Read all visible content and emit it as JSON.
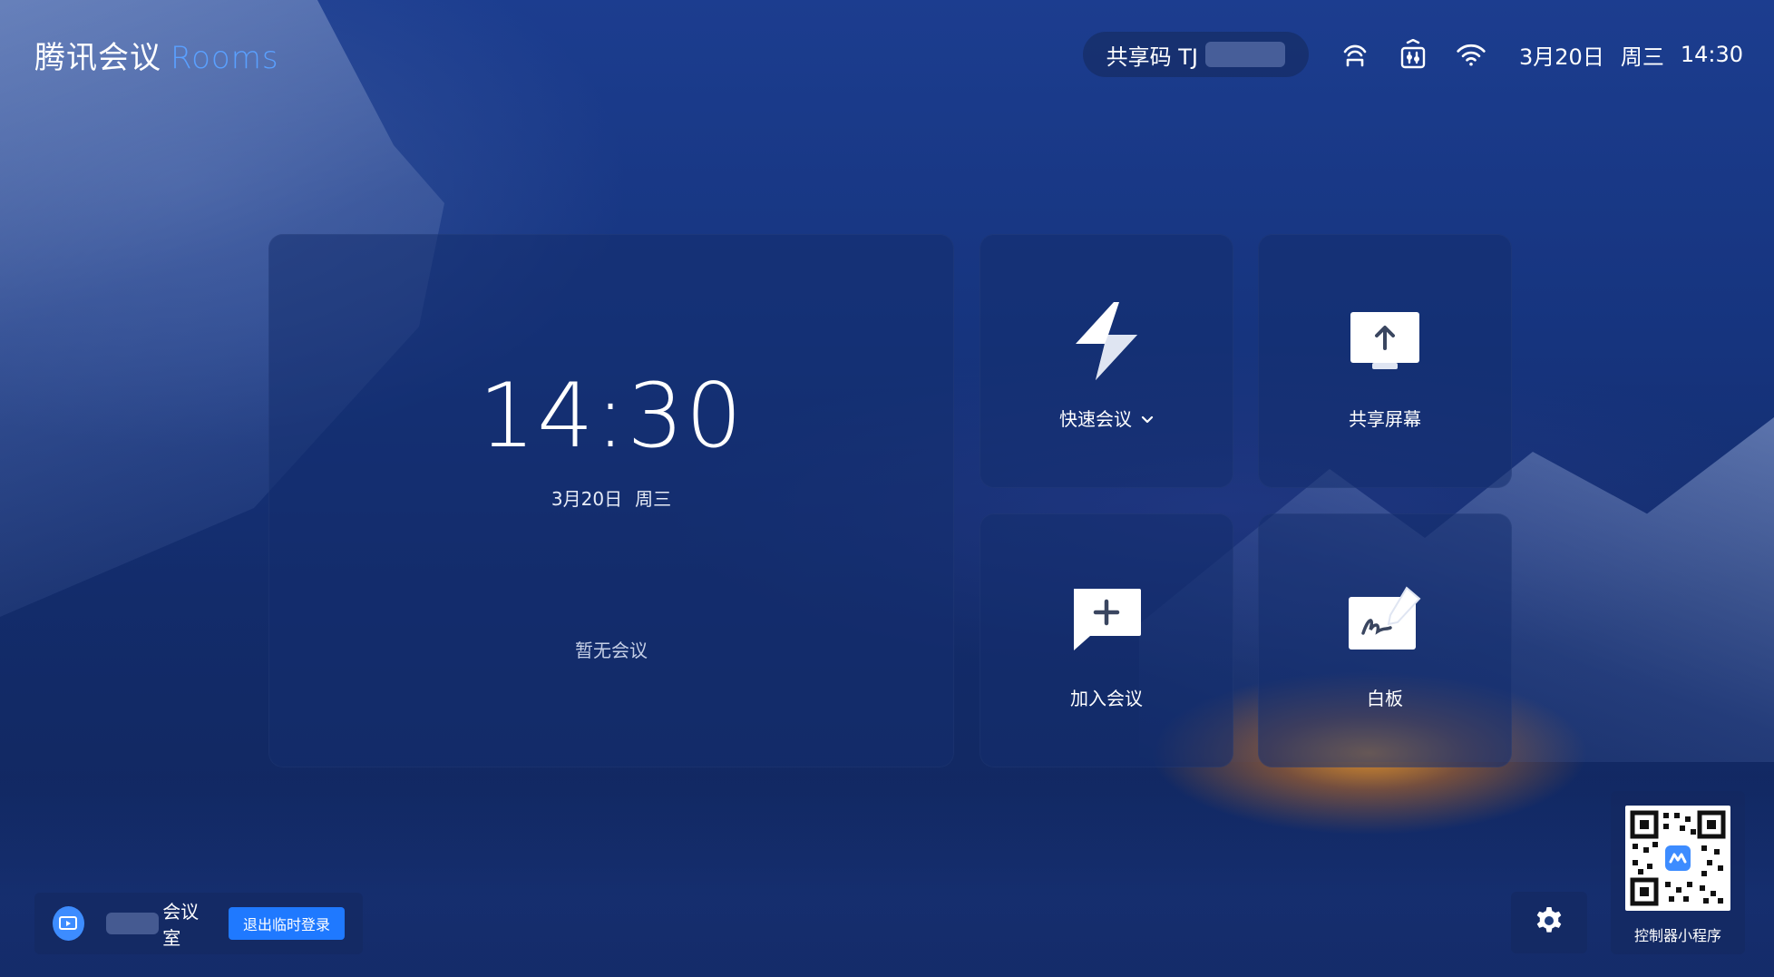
{
  "brand": {
    "name": "腾讯会议",
    "sub": "Rooms"
  },
  "status_bar": {
    "share_code_label": "共享码 TJ",
    "date": "3月20日",
    "weekday": "周三",
    "time": "14:30",
    "icons": [
      "cast-icon",
      "controller-icon",
      "wifi-icon"
    ]
  },
  "clock_card": {
    "time": "14:30",
    "date": "3月20日",
    "weekday": "周三",
    "empty_text": "暂无会议"
  },
  "tiles": {
    "quick": {
      "label": "快速会议",
      "icon": "lightning-icon"
    },
    "share": {
      "label": "共享屏幕",
      "icon": "screen-share-icon"
    },
    "join": {
      "label": "加入会议",
      "icon": "join-meeting-icon"
    },
    "board": {
      "label": "白板",
      "icon": "whiteboard-icon"
    }
  },
  "room": {
    "name": "会议室",
    "logout_label": "退出临时登录"
  },
  "qr": {
    "label": "控制器小程序"
  },
  "colors": {
    "accent": "#1f79ff",
    "brand_sub": "#5aa0ff",
    "card_bg": "rgba(20,45,110,0.55)"
  }
}
